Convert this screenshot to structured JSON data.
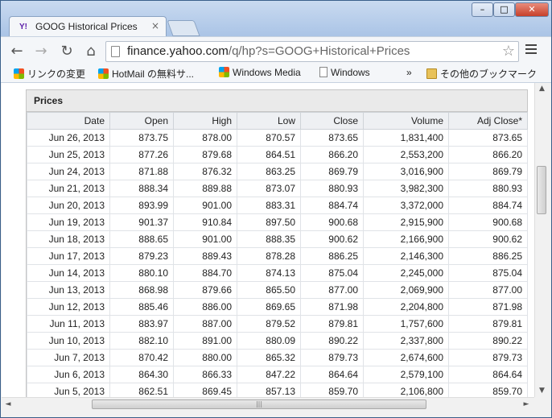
{
  "tab": {
    "title": "GOOG Historical Prices",
    "favicon": "Y!",
    "close": "×"
  },
  "window_controls": {
    "minimize": "–",
    "maximize": "□",
    "close": "✕"
  },
  "toolbar": {
    "back": "←",
    "forward": "→",
    "reload": "↻",
    "home": "⌂",
    "url_host": "finance.yahoo.com",
    "url_path": "/q/hp?s=GOOG+Historical+Prices",
    "star": "☆"
  },
  "bookmarks": {
    "items": [
      {
        "label": "リンクの変更",
        "icon": "windows-icon"
      },
      {
        "label": "HotMail の無料サ...",
        "icon": "windows-flag-icon"
      },
      {
        "label": "Windows Media",
        "icon": "windows-flag-icon"
      },
      {
        "label": "Windows",
        "icon": "page-icon"
      }
    ],
    "overflow": "»",
    "other": "その他のブックマーク"
  },
  "prices": {
    "heading": "Prices",
    "columns": [
      "Date",
      "Open",
      "High",
      "Low",
      "Close",
      "Volume",
      "Adj Close*"
    ],
    "rows": [
      [
        "Jun 26, 2013",
        "873.75",
        "878.00",
        "870.57",
        "873.65",
        "1,831,400",
        "873.65"
      ],
      [
        "Jun 25, 2013",
        "877.26",
        "879.68",
        "864.51",
        "866.20",
        "2,553,200",
        "866.20"
      ],
      [
        "Jun 24, 2013",
        "871.88",
        "876.32",
        "863.25",
        "869.79",
        "3,016,900",
        "869.79"
      ],
      [
        "Jun 21, 2013",
        "888.34",
        "889.88",
        "873.07",
        "880.93",
        "3,982,300",
        "880.93"
      ],
      [
        "Jun 20, 2013",
        "893.99",
        "901.00",
        "883.31",
        "884.74",
        "3,372,000",
        "884.74"
      ],
      [
        "Jun 19, 2013",
        "901.37",
        "910.84",
        "897.50",
        "900.68",
        "2,915,900",
        "900.68"
      ],
      [
        "Jun 18, 2013",
        "888.65",
        "901.00",
        "888.35",
        "900.62",
        "2,166,900",
        "900.62"
      ],
      [
        "Jun 17, 2013",
        "879.23",
        "889.43",
        "878.28",
        "886.25",
        "2,146,300",
        "886.25"
      ],
      [
        "Jun 14, 2013",
        "880.10",
        "884.70",
        "874.13",
        "875.04",
        "2,245,000",
        "875.04"
      ],
      [
        "Jun 13, 2013",
        "868.98",
        "879.66",
        "865.50",
        "877.00",
        "2,069,900",
        "877.00"
      ],
      [
        "Jun 12, 2013",
        "885.46",
        "886.00",
        "869.65",
        "871.98",
        "2,204,800",
        "871.98"
      ],
      [
        "Jun 11, 2013",
        "883.97",
        "887.00",
        "879.52",
        "879.81",
        "1,757,600",
        "879.81"
      ],
      [
        "Jun 10, 2013",
        "882.10",
        "891.00",
        "880.09",
        "890.22",
        "2,337,800",
        "890.22"
      ],
      [
        "Jun 7, 2013",
        "870.42",
        "880.00",
        "865.32",
        "879.73",
        "2,674,600",
        "879.73"
      ],
      [
        "Jun 6, 2013",
        "864.30",
        "866.33",
        "847.22",
        "864.64",
        "2,579,100",
        "864.64"
      ],
      [
        "Jun 5, 2013",
        "862.51",
        "869.45",
        "857.13",
        "859.70",
        "2,106,800",
        "859.70"
      ]
    ]
  },
  "scrollbar": {
    "up": "▲",
    "down": "▼",
    "left": "◄",
    "right": "►",
    "grip": "|||"
  }
}
